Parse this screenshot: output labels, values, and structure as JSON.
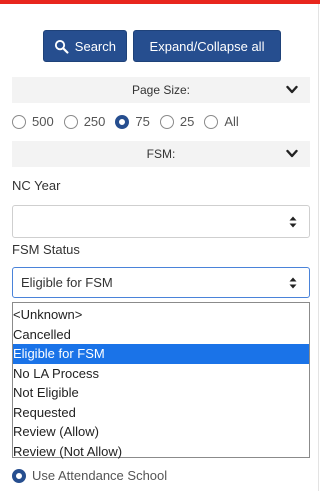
{
  "toolbar": {
    "search_label": "Search",
    "expand_label": "Expand/Collapse all"
  },
  "page_size": {
    "title": "Page Size:",
    "options": [
      "500",
      "250",
      "75",
      "25",
      "All"
    ],
    "selected": "75"
  },
  "fsm_section": {
    "title": "FSM:"
  },
  "nc_year": {
    "label": "NC Year",
    "value": ""
  },
  "fsm_status": {
    "label": "FSM Status",
    "value": "Eligible for FSM",
    "options": [
      "<Unknown>",
      "Cancelled",
      "Eligible for FSM",
      "No LA Process",
      "Not Eligible",
      "Requested",
      "Review (Allow)",
      "Review (Not Allow)"
    ]
  },
  "attendance": {
    "label": "Use Attendance School"
  },
  "colors": {
    "accent": "#264e8f",
    "top_bar": "#e8261d",
    "selection": "#1a73e8"
  },
  "icons": [
    "search-icon",
    "chevron-down-icon",
    "select-arrows-icon"
  ]
}
